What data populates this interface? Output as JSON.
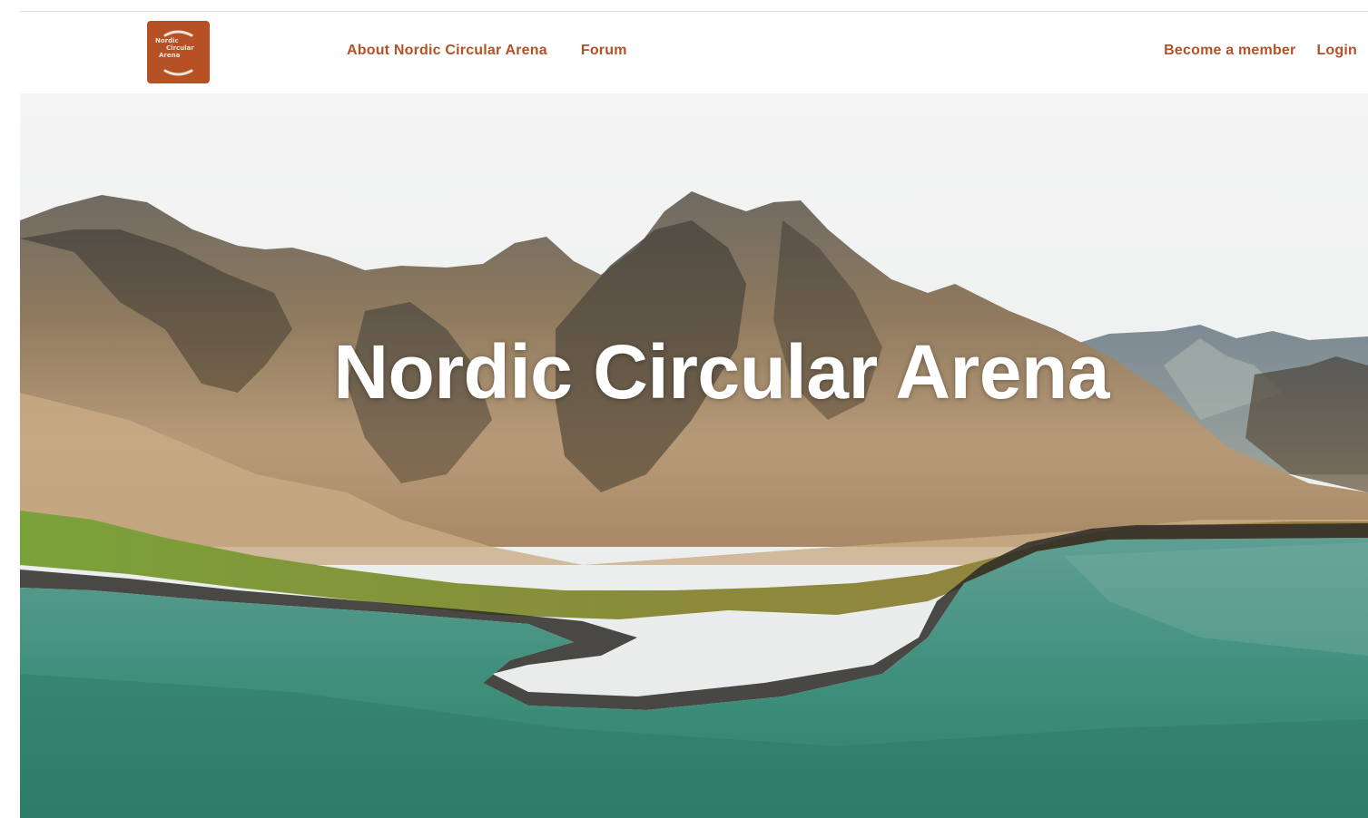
{
  "header": {
    "logo": {
      "line1": "Nordic",
      "line2": "Circular",
      "line3": "Arena",
      "color": "#b65126"
    },
    "nav_left": [
      {
        "label": "About Nordic Circular Arena"
      },
      {
        "label": "Forum"
      }
    ],
    "nav_right": [
      {
        "label": "Become a member"
      },
      {
        "label": "Login"
      }
    ],
    "link_color": "#b65126"
  },
  "hero": {
    "title": "Nordic Circular Arena",
    "image": "mountain-fjord-landscape"
  }
}
